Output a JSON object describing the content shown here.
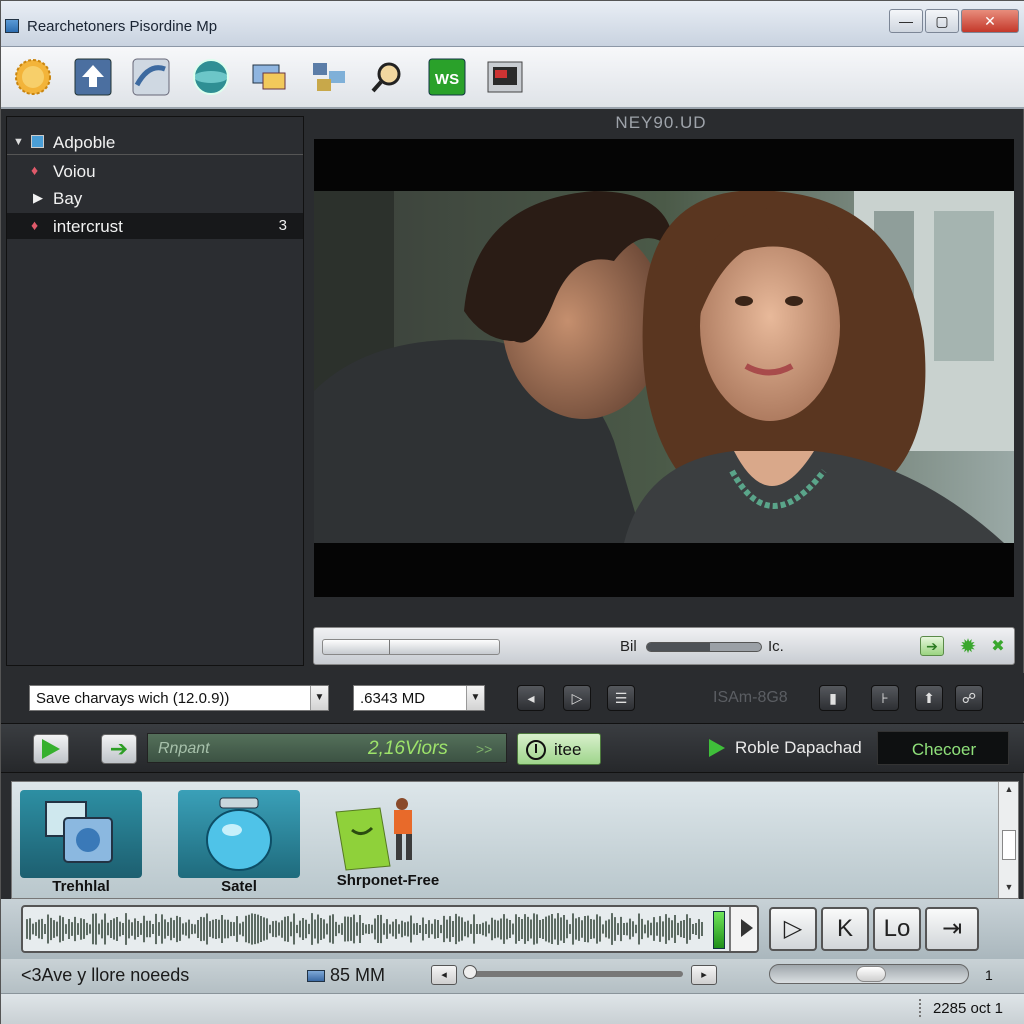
{
  "window": {
    "title": "Rearchetoners Pisordine Mp",
    "controls": {
      "minimize": "—",
      "maximize": "▢",
      "close": "✕"
    }
  },
  "toolbar": {
    "buttons": [
      {
        "name": "badge-icon",
        "label": ""
      },
      {
        "name": "upload-icon",
        "label": ""
      },
      {
        "name": "stream-icon",
        "label": ""
      },
      {
        "name": "globe-icon",
        "label": ""
      },
      {
        "name": "monitor-icon",
        "label": ""
      },
      {
        "name": "network-icon",
        "label": ""
      },
      {
        "name": "magnifier-icon",
        "label": ""
      },
      {
        "name": "ws-icon",
        "label": "WS"
      },
      {
        "name": "film-icon",
        "label": ""
      }
    ]
  },
  "tree": {
    "items": [
      {
        "label": "Adpoble",
        "icon": "folder-icon",
        "expanded": true
      },
      {
        "label": "Voiou",
        "icon": "pin-icon"
      },
      {
        "label": "Bay",
        "icon": "play-icon"
      },
      {
        "label": "intercrust",
        "icon": "pin-icon",
        "count": "3",
        "selected": true
      }
    ]
  },
  "video": {
    "label": "NEY90.UD"
  },
  "seek": {
    "label_bil": "Bil",
    "label_lc": "Ic.",
    "volume_fraction": 0.55
  },
  "selectors": {
    "save_combo": "Save charvays wich (12.0.9))",
    "size_combo": ".6343 MD",
    "ghost_text": "ISAm-8G8"
  },
  "action": {
    "progress_label": "Rnpant",
    "progress_value": "2,16Viors",
    "progress_chevrons": ">>",
    "itee_label": "itee",
    "status_text": "Roble Dapachad",
    "checker_label": "Checoer"
  },
  "strip": {
    "items": [
      {
        "label": "Trehhlal",
        "icon": "photo-icon"
      },
      {
        "label": "Satel",
        "icon": "jar-icon"
      },
      {
        "label": "Shrponet-Free",
        "icon": "figure-icon"
      }
    ]
  },
  "transport": {
    "play": "▷",
    "k": "K",
    "lo": "Lo",
    "skip": "⇥"
  },
  "bottom": {
    "status_text": "<3Ave y llore noeeds",
    "size_text": "85 MM",
    "zoom_num": "1"
  },
  "statusbar": {
    "right_text": "2285 oct 1"
  },
  "colors": {
    "accent_green": "#3fbf3a",
    "progress_green": "#9de36a",
    "dark_panel": "#2b2d31"
  }
}
